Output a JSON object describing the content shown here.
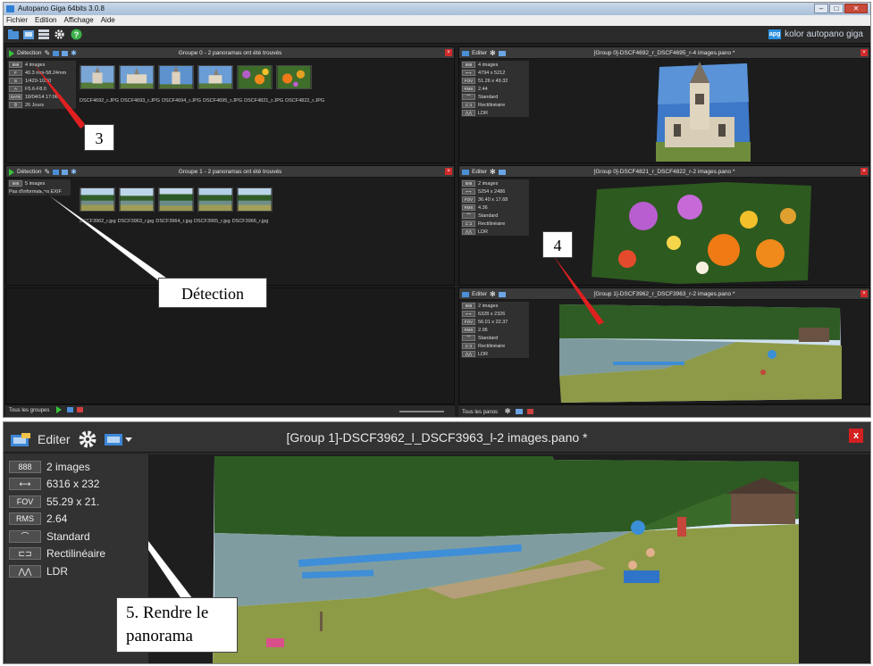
{
  "app": {
    "window_title": "Autopano Giga 64bits 3.0.8",
    "menu": [
      "Fichier",
      "Edition",
      "Affichage",
      "Aide"
    ],
    "brand": "kolor autopano giga",
    "brand_logo": "apg"
  },
  "groups": [
    {
      "detect_label": "Détection",
      "title": "Groupe 0 - 2 panoramas ont été trouvés",
      "info": [
        "4 images",
        "40.3 mm-58.24mm",
        "1/420-1/250",
        "F5.6-F8.0",
        "18/04/14 17:06",
        "26 Jours"
      ],
      "info_icons": [
        "888",
        "F",
        "S",
        "A",
        "DATE",
        "⏲"
      ],
      "thumb_labels": [
        "DSCF4692_r.JPG",
        "DSCF4693_r.JPG",
        "DSCF4694_r.JPG",
        "DSCF4695_r.JPG",
        "DSCF4821_r.JPG",
        "DSCF4822_r.JPG"
      ]
    },
    {
      "detect_label": "Détection",
      "title": "Groupe 1 - 2 panoramas ont été trouvés",
      "info": [
        "5 images",
        "Pas d'informations EXIF"
      ],
      "info_icons": [
        "888"
      ],
      "thumb_labels": [
        "DSCF3962_r.jpg",
        "DSCF3963_r.jpg",
        "DSCF3964_r.jpg",
        "DSCF3965_r.jpg",
        "DSCF3966_r.jpg"
      ]
    }
  ],
  "groups_footer": "Tous les groupes",
  "panos": [
    {
      "edit_label": "Editer",
      "title": "[Group 0]-DSCF4692_r_DSCF4695_r-4 images.pano *",
      "info": [
        "4 images",
        "4794 x 5212",
        "51.26 x 49.32",
        "2.44",
        "Standard",
        "Rectilinéaire",
        "LDR"
      ]
    },
    {
      "edit_label": "Editer",
      "title": "[Group 0]-DSCF4821_r_DSCF4822_r-2 images.pano *",
      "info": [
        "2 images",
        "5254 x 2486",
        "36.40 x 17.68",
        "4.36",
        "Standard",
        "Rectilinéaire",
        "LDR"
      ]
    },
    {
      "edit_label": "Editer",
      "title": "[Group 1]-DSCF3962_r_DSCF3963_r-2 images.pano *",
      "info": [
        "2 images",
        "6328 x 2326",
        "56.01 x 22.37",
        "2.96",
        "Standard",
        "Rectilinéaire",
        "LDR"
      ]
    }
  ],
  "panos_footer": "Tous les panos",
  "pano_icon_labels": [
    "888",
    "⟷",
    "FOV",
    "RMS",
    "⌒",
    "⊏⊐",
    "⋀⋀"
  ],
  "zoom": {
    "edit_label": "Editer",
    "title": "[Group 1]-DSCF3962_l_DSCF3963_l-2 images.pano *",
    "close": "x",
    "icons": [
      "888",
      "⟷",
      "FOV",
      "RMS",
      "⌒",
      "⊏⊐",
      "⋀⋀"
    ],
    "values": [
      "2 images",
      "6316 x 232",
      "55.29 x 21.",
      "2.64",
      "Standard",
      "Rectilinéaire",
      "LDR"
    ]
  },
  "callouts": {
    "c3": "3",
    "detection": "Détection",
    "c4": "4",
    "render_line1": "5. Rendre le",
    "render_line2": "panorama"
  },
  "colors": {
    "app_bg": "#1e1e1e",
    "panel_header": "#3a3a3a",
    "play_green": "#37c43b",
    "close_red": "#d02a2a",
    "arrow_red": "#e02020",
    "brand_blue": "#2b8fe0"
  }
}
